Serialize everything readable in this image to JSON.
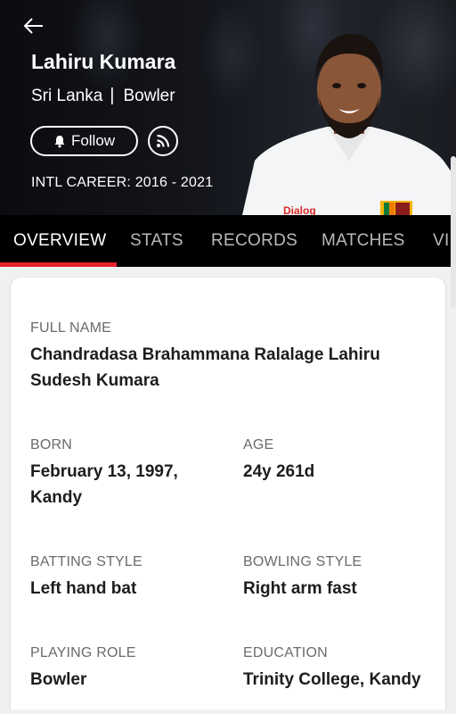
{
  "header": {
    "name": "Lahiru Kumara",
    "country": "Sri Lanka",
    "separator": "|",
    "role": "Bowler",
    "follow_label": "Follow",
    "career": "INTL CAREER: 2016 - 2021",
    "icons": {
      "back": "arrow-left-icon",
      "follow": "bell-icon",
      "feed": "rss-icon"
    },
    "photo_sponsor": "Dialog"
  },
  "tabs": [
    {
      "label": "OVERVIEW",
      "active": true
    },
    {
      "label": "STATS",
      "active": false
    },
    {
      "label": "RECORDS",
      "active": false
    },
    {
      "label": "MATCHES",
      "active": false
    },
    {
      "label": "VIDEOS",
      "active": false
    }
  ],
  "profile": {
    "full_name": {
      "label": "FULL NAME",
      "value": "Chandradasa Brahammana Ralalage Lahiru Sudesh Kumara"
    },
    "born": {
      "label": "BORN",
      "value": "February 13, 1997, Kandy"
    },
    "age": {
      "label": "AGE",
      "value": "24y 261d"
    },
    "batting_style": {
      "label": "BATTING STYLE",
      "value": "Left hand bat"
    },
    "bowling_style": {
      "label": "BOWLING STYLE",
      "value": "Right arm fast"
    },
    "playing_role": {
      "label": "PLAYING ROLE",
      "value": "Bowler"
    },
    "education": {
      "label": "EDUCATION",
      "value": "Trinity College, Kandy"
    }
  },
  "colors": {
    "accent": "#e8232a",
    "tab_bar": "#000000",
    "page_bg": "#f1f1f1"
  }
}
